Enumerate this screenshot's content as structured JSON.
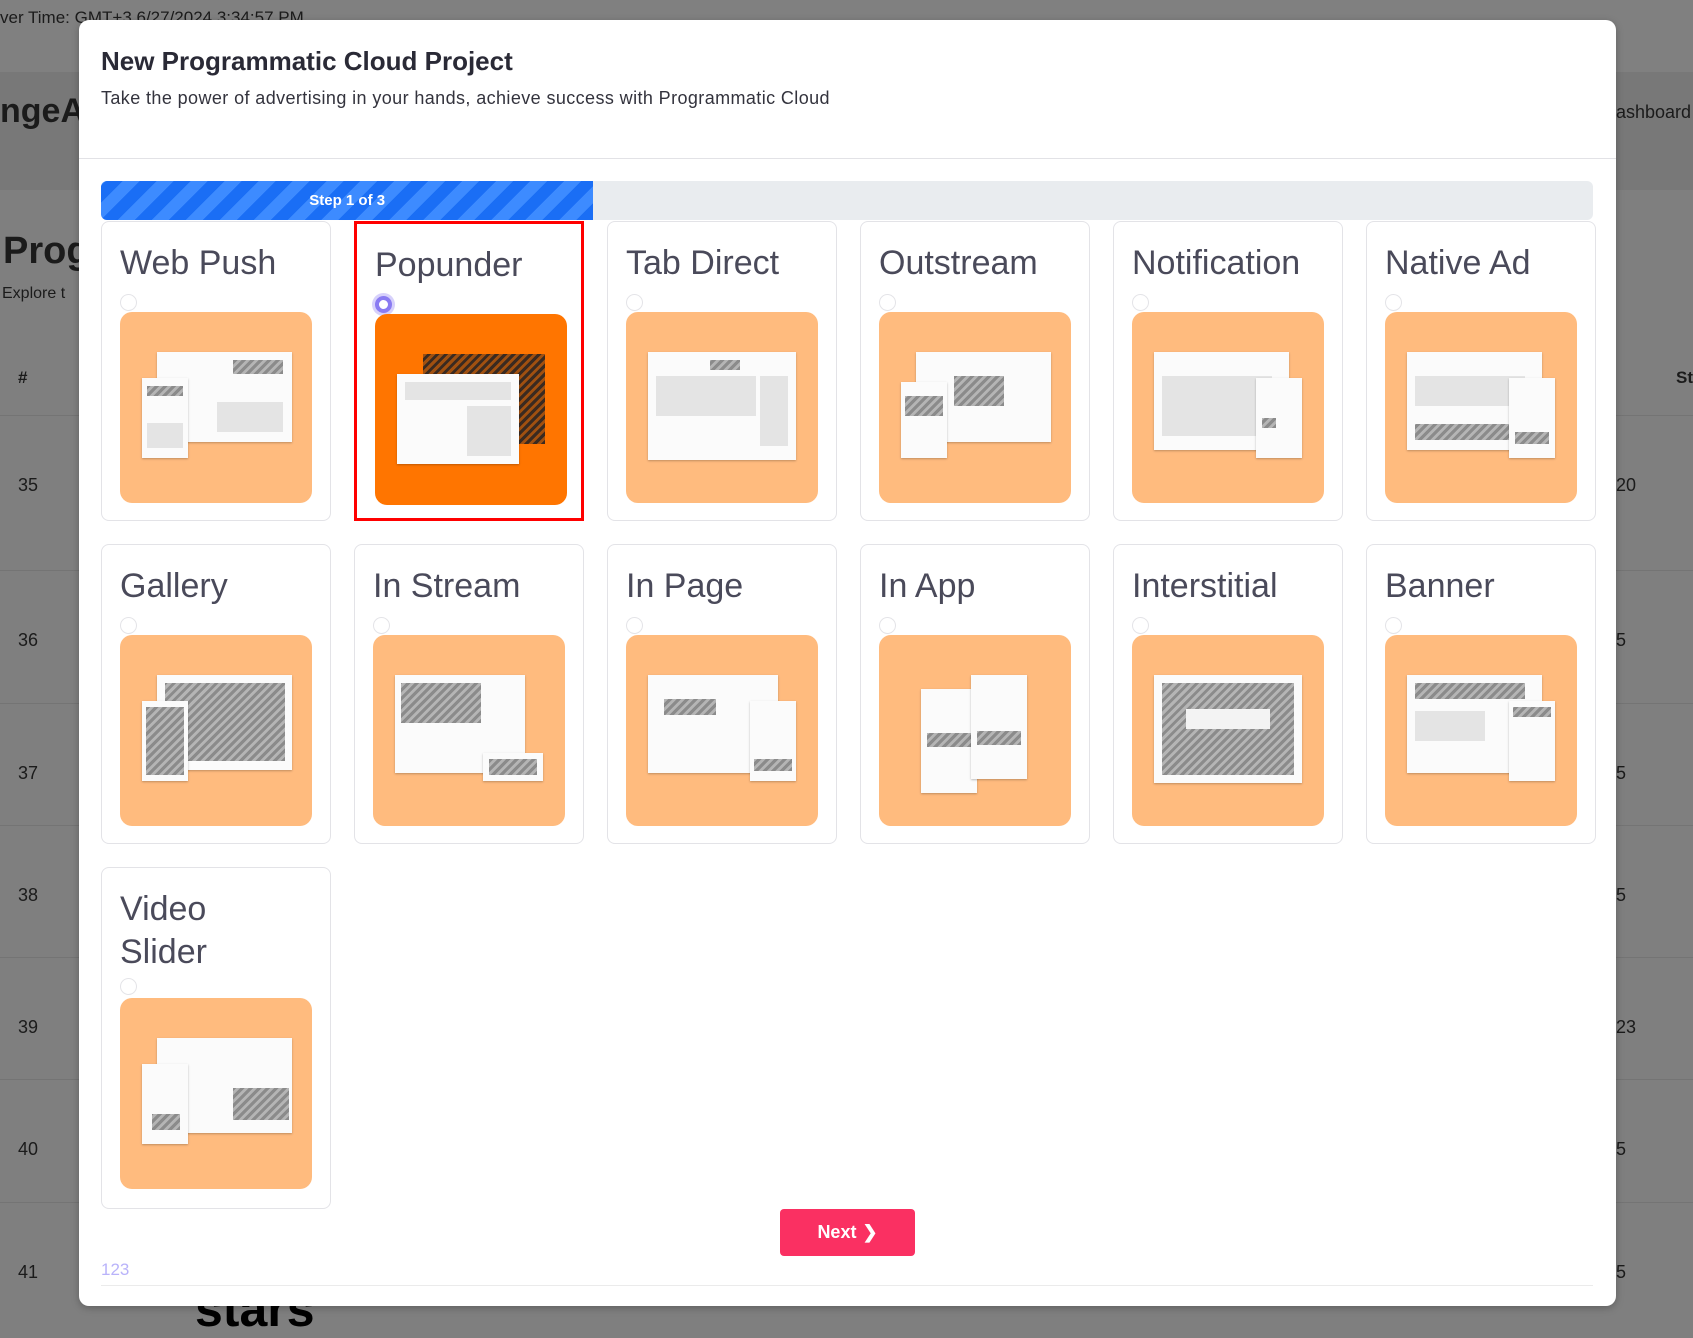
{
  "background": {
    "server_time": "ver Time: GMT+3 6/27/2024 3:34:57 PM",
    "brand_fragment": "ngeAc",
    "breadcrumb_fragment": "ashboard",
    "page_title_fragment": "Prog",
    "page_sub_fragment": "Explore t",
    "col_hash": "#",
    "col_status_fragment": "St",
    "rows": [
      {
        "n": "35",
        "v": "20"
      },
      {
        "n": "36",
        "v": "5"
      },
      {
        "n": "37",
        "v": "5"
      },
      {
        "n": "38",
        "v": "5"
      },
      {
        "n": "39",
        "v": "23"
      },
      {
        "n": "40",
        "v": "5"
      },
      {
        "n": "41",
        "v": "5"
      }
    ],
    "footer_fragment": "stars"
  },
  "modal": {
    "title": "New Programmatic Cloud Project",
    "subtitle": "Take the power of advertising in your hands, achieve success with Programmatic Cloud",
    "progress": {
      "label": "Step 1 of 3",
      "percent": 33,
      "color": "#1a6ef5"
    },
    "selected": "Popunder",
    "ad_types": [
      "Web Push",
      "Popunder",
      "Tab Direct",
      "Outstream",
      "Notification",
      "Native Ad",
      "Gallery",
      "In Stream",
      "In Page",
      "In App",
      "Interstitial",
      "Banner",
      "Video Slider"
    ],
    "next_label": "Next",
    "step_indicator": "123",
    "colors": {
      "accent": "#fa3062",
      "thumb": "#ffbb7e",
      "thumb_selected": "#ff7500",
      "selection_border": "#ff0000",
      "radio": "#8a7bf2"
    }
  }
}
